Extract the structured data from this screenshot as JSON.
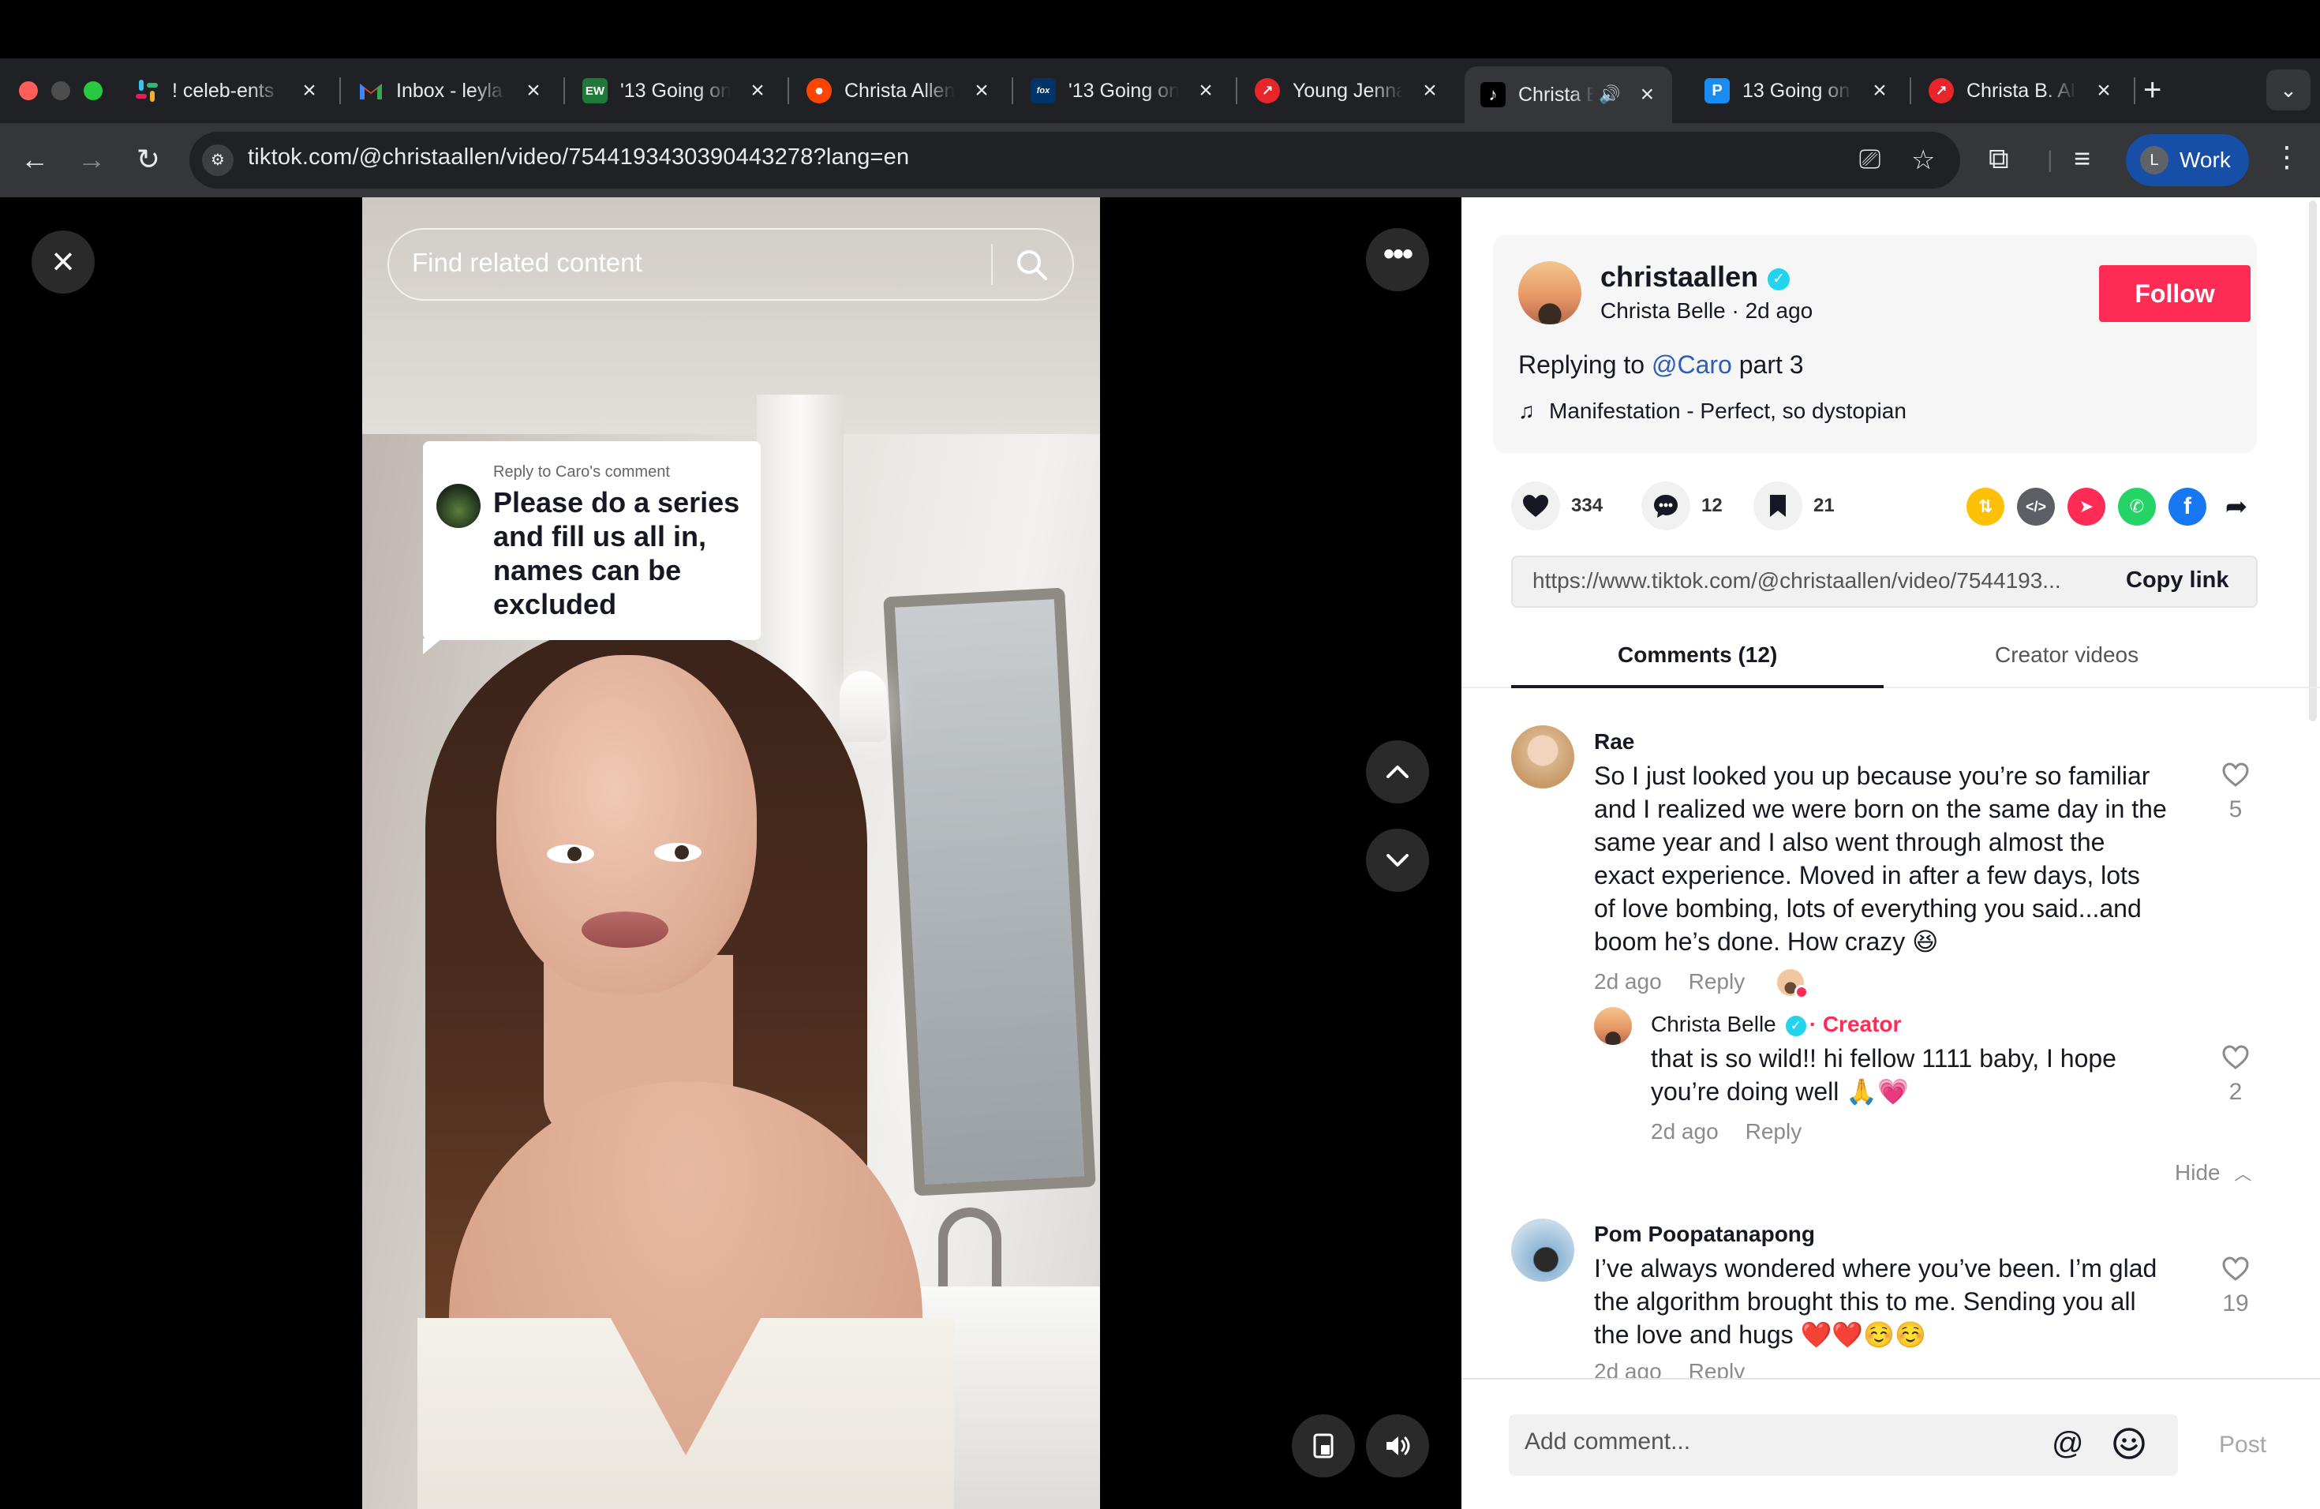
{
  "browser": {
    "tabs": [
      {
        "title": "! celeb-ents",
        "favicon": "slack-icon",
        "active": false
      },
      {
        "title": "Inbox - leyla",
        "favicon": "gmail-icon",
        "active": false
      },
      {
        "title": "'13 Going on",
        "favicon": "ew-icon",
        "active": false
      },
      {
        "title": "Christa Allen",
        "favicon": "reddit-icon",
        "active": false
      },
      {
        "title": "'13 Going on",
        "favicon": "fox-news-icon",
        "active": false
      },
      {
        "title": "Young Jenna",
        "favicon": "trending-icon",
        "active": false
      },
      {
        "title": "Christa B",
        "favicon": "tiktok-icon",
        "active": true,
        "audio": true
      },
      {
        "title": "13 Going on",
        "favicon": "p-icon",
        "active": false
      },
      {
        "title": "Christa B. Al",
        "favicon": "trending-icon",
        "active": false
      }
    ],
    "fav_text": {
      "ew": "EW",
      "p": "P",
      "fox": "fox"
    },
    "url": "tiktok.com/@christaallen/video/7544193430390443278?lang=en",
    "profile_initial": "L",
    "profile_label": "Work",
    "colors": {
      "accent": "#fe2c55",
      "profile": "#174ea6"
    }
  },
  "video": {
    "search_placeholder": "Find related content",
    "reply_card": {
      "heading": "Reply to Caro's comment",
      "text": "Please do a series and fill us all in, names can be excluded"
    }
  },
  "panel": {
    "author": {
      "handle": "christaallen",
      "subline": "Christa Belle · 2d ago",
      "follow_label": "Follow"
    },
    "caption": {
      "prefix": "Replying to ",
      "mention": "@Caro",
      "suffix": " part 3"
    },
    "music": "Manifestation - Perfect, so dystopian",
    "stats": {
      "likes": "334",
      "comments": "12",
      "saves": "21"
    },
    "share_icons": [
      "repost-icon",
      "embed-icon",
      "send-icon",
      "whatsapp-icon",
      "facebook-icon",
      "share-arrow-icon"
    ],
    "link": {
      "url": "https://www.tiktok.com/@christaallen/video/7544193...",
      "copy_label": "Copy link"
    },
    "tabs": {
      "comments": "Comments (12)",
      "creator": "Creator videos"
    },
    "comments": [
      {
        "name": "Rae",
        "lines": [
          "So I just looked you up because you’re so familiar",
          "and I realized we were born on the same day in the",
          "same year and I also went through almost the",
          "exact experience. Moved in after a few days, lots",
          "of love bombing, lots of everything you said...and",
          "boom he’s done. How crazy 😆"
        ],
        "time": "2d ago",
        "reply": "Reply",
        "likes": "5"
      },
      {
        "name": "Christa Belle",
        "creator_tag": "· Creator",
        "lines": [
          "that is so wild!! hi fellow 1111 baby, I hope",
          "you’re doing well 🙏💗"
        ],
        "time": "2d ago",
        "reply": "Reply",
        "likes": "2"
      },
      {
        "name": "Pom Poopatanapong",
        "lines": [
          "I’ve always wondered where you’ve been. I’m glad",
          "the algorithm brought this to me. Sending you all",
          "the love and hugs ❤️❤️☺️☺️"
        ],
        "time": "2d ago",
        "reply": "Reply",
        "likes": "19"
      }
    ],
    "hide_label": "Hide",
    "add_comment_placeholder": "Add comment...",
    "post_label": "Post"
  }
}
